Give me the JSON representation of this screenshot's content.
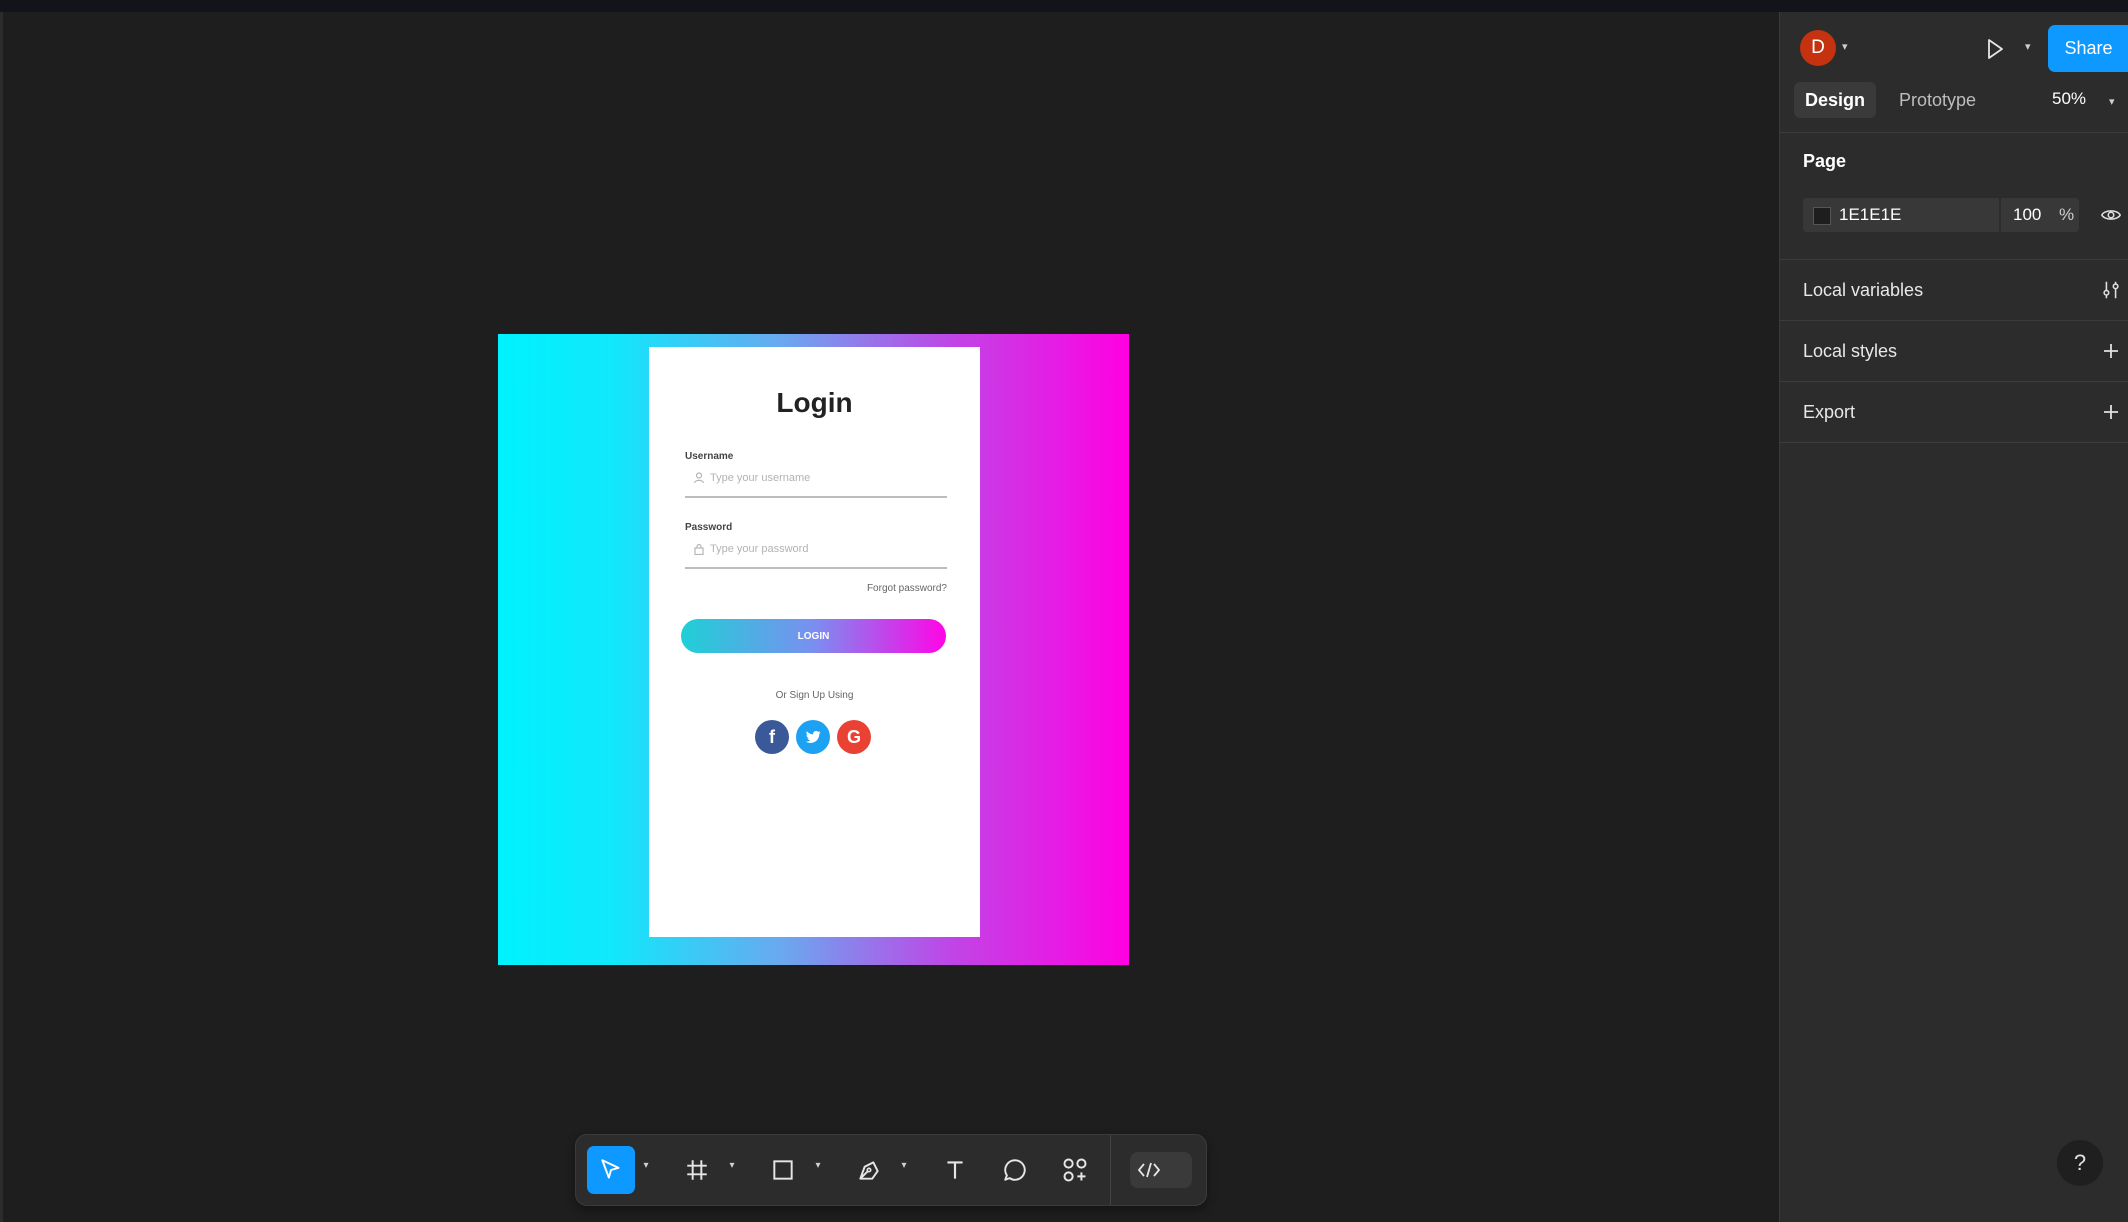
{
  "canvas": {
    "artboard_gradient": [
      "#00f2ff",
      "#ff00e2"
    ],
    "login_card": {
      "title": "Login",
      "username_label": "Username",
      "username_placeholder": "Type your username",
      "password_label": "Password",
      "password_placeholder": "Type your password",
      "forgot": "Forgot password?",
      "login_button": "LOGIN",
      "signup_text": "Or Sign Up Using",
      "social": {
        "facebook": "f",
        "google": "G"
      }
    }
  },
  "toolbar": {
    "tools": [
      "move-tool",
      "frame-tool",
      "rectangle-tool",
      "pen-tool",
      "text-tool",
      "comment-tool",
      "actions-tool",
      "dev-mode-toggle"
    ],
    "accent": "#0d99ff"
  },
  "panel": {
    "avatar_letter": "D",
    "share_label": "Share",
    "tabs": [
      "Design",
      "Prototype"
    ],
    "zoom": "50%",
    "page_section": "Page",
    "page_color_hex": "1E1E1E",
    "page_opacity": "100",
    "page_opacity_unit": "%",
    "local_variables": "Local variables",
    "local_styles": "Local styles",
    "export": "Export",
    "help": "?"
  }
}
